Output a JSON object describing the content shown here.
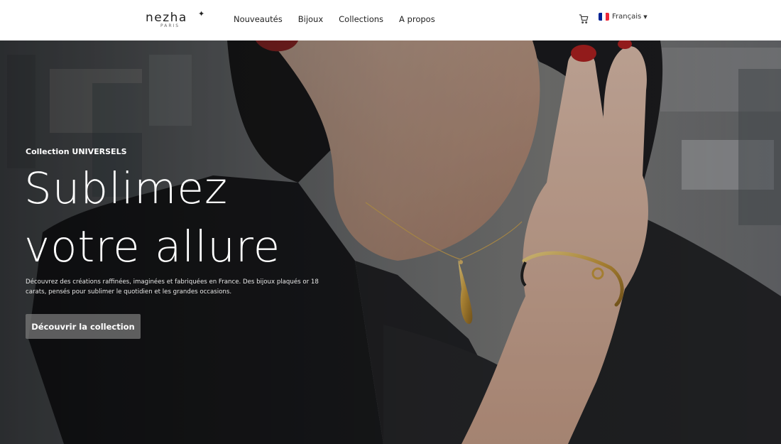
{
  "brand": {
    "name": "nezha",
    "sparkle": "✦",
    "tagline": "PARIS"
  },
  "nav": {
    "links": [
      "Nouveautés",
      "Bijoux",
      "Collections",
      "A propos"
    ]
  },
  "header": {
    "cart_icon": "shopping-cart-icon",
    "language": {
      "label": "Français",
      "flag_colors": [
        "#002395",
        "#ffffff",
        "#ed2939"
      ]
    }
  },
  "hero": {
    "eyebrow": "Collection UNIVERSELS",
    "headline_line1": "Sublimez",
    "headline_line2": "votre allure",
    "description_line1": "Découvrez des créations raffinées, imaginées et fabriquées en France. Des bijoux plaqués or 18",
    "description_line2": "carats, pensés pour sublimer le quotidien et les grandes occasions.",
    "cta_label": "Découvrir la collection"
  },
  "colors": {
    "header_bg": "#ffffff",
    "text_dark": "#222222",
    "hero_overlay": "#000000"
  }
}
